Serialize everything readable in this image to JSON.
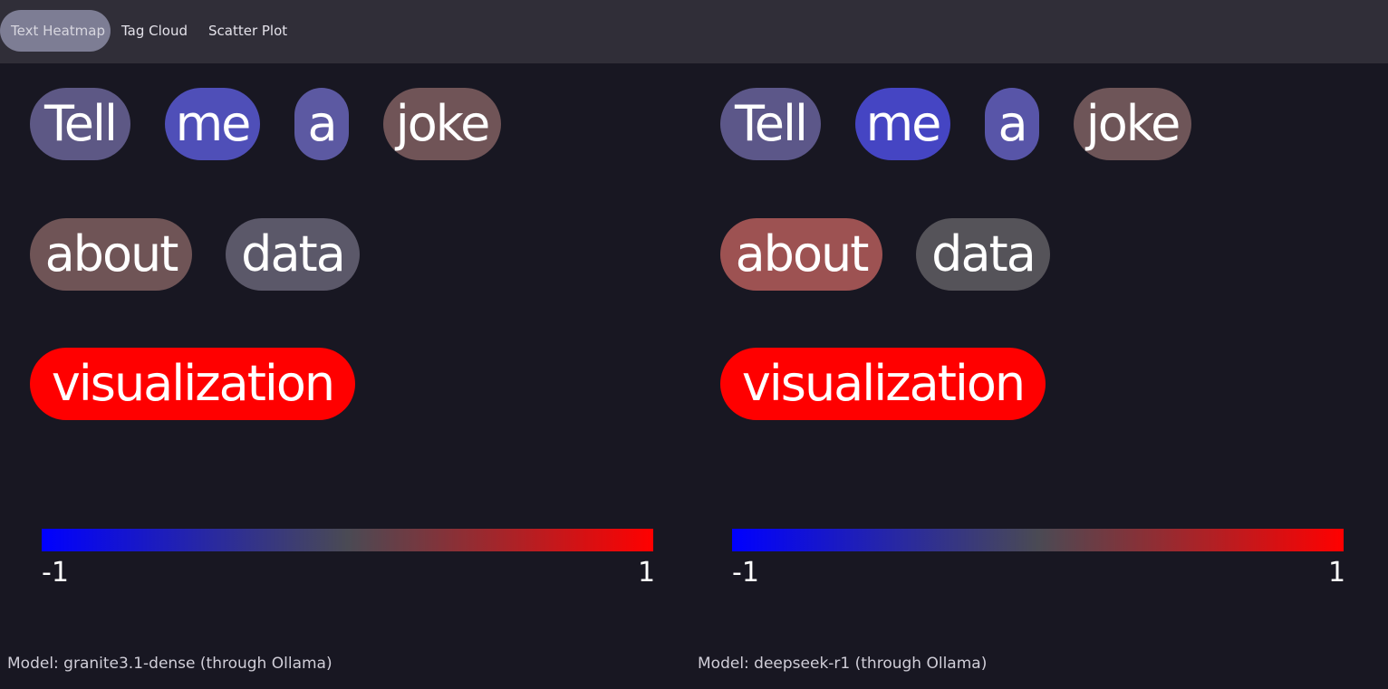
{
  "tabs": [
    {
      "label": "Text Heatmap",
      "active": true
    },
    {
      "label": "Tag Cloud",
      "active": false
    },
    {
      "label": "Scatter Plot",
      "active": false
    }
  ],
  "colors": {
    "topbar": "#302e38",
    "background": "#181722",
    "scale_min": "#0000ff",
    "scale_mid": "#4a4a54",
    "scale_max": "#ff0000"
  },
  "colorbar": {
    "min_label": "-1",
    "max_label": "1"
  },
  "panels": [
    {
      "caption": "Model: granite3.1-dense (through Ollama)",
      "tokens": [
        {
          "text": "Tell",
          "color": "#5d5885"
        },
        {
          "text": "me",
          "color": "#4f4fb8"
        },
        {
          "text": "a",
          "color": "#5c59a2"
        },
        {
          "text": "joke",
          "color": "#705457"
        },
        {
          "text": "about",
          "color": "#6f5456"
        },
        {
          "text": "data",
          "color": "#5b5869"
        },
        {
          "text": "visualization",
          "color": "#ff0000"
        }
      ]
    },
    {
      "caption": "Model: deepseek-r1 (through Ollama)",
      "tokens": [
        {
          "text": "Tell",
          "color": "#5c5789"
        },
        {
          "text": "me",
          "color": "#4545c3"
        },
        {
          "text": "a",
          "color": "#5855a8"
        },
        {
          "text": "joke",
          "color": "#6e5558"
        },
        {
          "text": "about",
          "color": "#9d5252"
        },
        {
          "text": "data",
          "color": "#555359"
        },
        {
          "text": "visualization",
          "color": "#ff0000"
        }
      ]
    }
  ]
}
